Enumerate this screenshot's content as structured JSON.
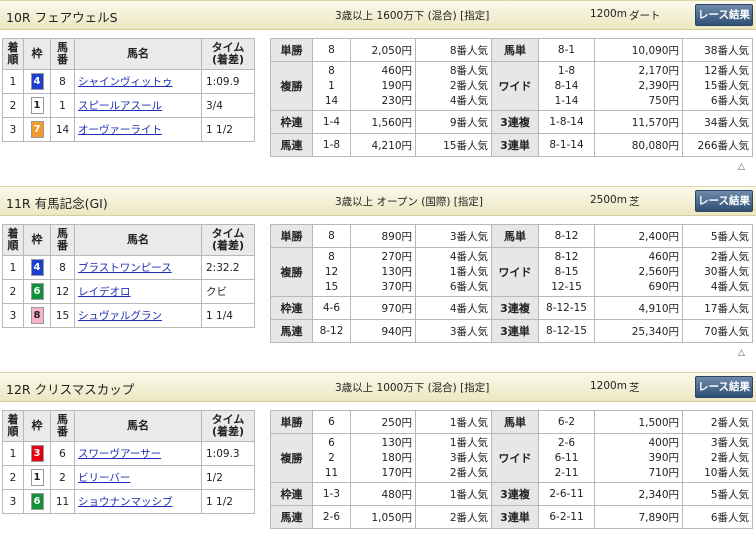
{
  "colors": {
    "waku1": "#ffffff",
    "waku3": "#e60012",
    "waku4": "#1d3fd0",
    "waku6": "#13913a",
    "waku7": "#f39a2b",
    "waku8": "#f6b3c6",
    "link": "#1c2fb5",
    "button": "#3f5f86"
  },
  "results_header": {
    "rank": "着順",
    "waku": "枠",
    "num": "馬番",
    "name": "馬名",
    "time": "タイム(着差)",
    "rank_l1": "着",
    "rank_l2": "順",
    "num_l1": "馬",
    "num_l2": "番",
    "time_l1": "タイム",
    "time_l2": "(着差)"
  },
  "up_arrow": "△",
  "races": [
    {
      "title": "10R フェアウェルS",
      "conditions": "3歳以上 1600万下 (混合) [指定]",
      "distance": "1200m",
      "surface": "ダート",
      "button": "レース結果",
      "results": [
        {
          "rank": "1",
          "waku": "4",
          "num": "8",
          "name": "シャインヴィットゥ",
          "time": "1:09.9"
        },
        {
          "rank": "2",
          "waku": "1",
          "num": "1",
          "name": "スピールアスール",
          "time": "3/4"
        },
        {
          "rank": "3",
          "waku": "7",
          "num": "14",
          "name": "オーヴァーライト",
          "time": "1 1/2"
        }
      ],
      "payouts": {
        "tansho": {
          "label": "単勝",
          "num": "8",
          "yen": "2,050円",
          "pop": "8番人気"
        },
        "fukusho": {
          "label": "複勝",
          "nums": [
            "8",
            "1",
            "14"
          ],
          "yens": [
            "460円",
            "190円",
            "230円"
          ],
          "pops": [
            "8番人気",
            "2番人気",
            "4番人気"
          ]
        },
        "wakuren": {
          "label": "枠連",
          "num": "1-4",
          "yen": "1,560円",
          "pop": "9番人気"
        },
        "umaren": {
          "label": "馬連",
          "num": "1-8",
          "yen": "4,210円",
          "pop": "15番人気"
        },
        "umatan": {
          "label": "馬単",
          "num": "8-1",
          "yen": "10,090円",
          "pop": "38番人気"
        },
        "wide": {
          "label": "ワイド",
          "nums": [
            "1-8",
            "8-14",
            "1-14"
          ],
          "yens": [
            "2,170円",
            "2,390円",
            "750円"
          ],
          "pops": [
            "12番人気",
            "15番人気",
            "6番人気"
          ]
        },
        "sanrenpuku": {
          "label": "3連複",
          "num": "1-8-14",
          "yen": "11,570円",
          "pop": "34番人気"
        },
        "sanrentan": {
          "label": "3連単",
          "num": "8-1-14",
          "yen": "80,080円",
          "pop": "266番人気"
        }
      }
    },
    {
      "title": "11R 有馬記念(GI)",
      "conditions": "3歳以上 オープン (国際) [指定]",
      "distance": "2500m",
      "surface": "芝",
      "button": "レース結果",
      "results": [
        {
          "rank": "1",
          "waku": "4",
          "num": "8",
          "name": "ブラストワンピース",
          "time": "2:32.2"
        },
        {
          "rank": "2",
          "waku": "6",
          "num": "12",
          "name": "レイデオロ",
          "time": "クビ"
        },
        {
          "rank": "3",
          "waku": "8",
          "num": "15",
          "name": "シュヴァルグラン",
          "time": "1 1/4"
        }
      ],
      "payouts": {
        "tansho": {
          "label": "単勝",
          "num": "8",
          "yen": "890円",
          "pop": "3番人気"
        },
        "fukusho": {
          "label": "複勝",
          "nums": [
            "8",
            "12",
            "15"
          ],
          "yens": [
            "270円",
            "130円",
            "370円"
          ],
          "pops": [
            "4番人気",
            "1番人気",
            "6番人気"
          ]
        },
        "wakuren": {
          "label": "枠連",
          "num": "4-6",
          "yen": "970円",
          "pop": "4番人気"
        },
        "umaren": {
          "label": "馬連",
          "num": "8-12",
          "yen": "940円",
          "pop": "3番人気"
        },
        "umatan": {
          "label": "馬単",
          "num": "8-12",
          "yen": "2,400円",
          "pop": "5番人気"
        },
        "wide": {
          "label": "ワイド",
          "nums": [
            "8-12",
            "8-15",
            "12-15"
          ],
          "yens": [
            "460円",
            "2,560円",
            "690円"
          ],
          "pops": [
            "2番人気",
            "30番人気",
            "4番人気"
          ]
        },
        "sanrenpuku": {
          "label": "3連複",
          "num": "8-12-15",
          "yen": "4,910円",
          "pop": "17番人気"
        },
        "sanrentan": {
          "label": "3連単",
          "num": "8-12-15",
          "yen": "25,340円",
          "pop": "70番人気"
        }
      }
    },
    {
      "title": "12R クリスマスカップ",
      "conditions": "3歳以上 1000万下 (混合) [指定]",
      "distance": "1200m",
      "surface": "芝",
      "button": "レース結果",
      "results": [
        {
          "rank": "1",
          "waku": "3",
          "num": "6",
          "name": "スワーヴアーサー",
          "time": "1:09.3"
        },
        {
          "rank": "2",
          "waku": "1",
          "num": "2",
          "name": "ビリーバー",
          "time": "1/2"
        },
        {
          "rank": "3",
          "waku": "6",
          "num": "11",
          "name": "ショウナンマッシブ",
          "time": "1 1/2"
        }
      ],
      "payouts": {
        "tansho": {
          "label": "単勝",
          "num": "6",
          "yen": "250円",
          "pop": "1番人気"
        },
        "fukusho": {
          "label": "複勝",
          "nums": [
            "6",
            "2",
            "11"
          ],
          "yens": [
            "130円",
            "180円",
            "170円"
          ],
          "pops": [
            "1番人気",
            "3番人気",
            "2番人気"
          ]
        },
        "wakuren": {
          "label": "枠連",
          "num": "1-3",
          "yen": "480円",
          "pop": "1番人気"
        },
        "umaren": {
          "label": "馬連",
          "num": "2-6",
          "yen": "1,050円",
          "pop": "2番人気"
        },
        "umatan": {
          "label": "馬単",
          "num": "6-2",
          "yen": "1,500円",
          "pop": "2番人気"
        },
        "wide": {
          "label": "ワイド",
          "nums": [
            "2-6",
            "6-11",
            "2-11"
          ],
          "yens": [
            "400円",
            "390円",
            "710円"
          ],
          "pops": [
            "3番人気",
            "2番人気",
            "10番人気"
          ]
        },
        "sanrenpuku": {
          "label": "3連複",
          "num": "2-6-11",
          "yen": "2,340円",
          "pop": "5番人気"
        },
        "sanrentan": {
          "label": "3連単",
          "num": "6-2-11",
          "yen": "7,890円",
          "pop": "6番人気"
        }
      }
    }
  ]
}
